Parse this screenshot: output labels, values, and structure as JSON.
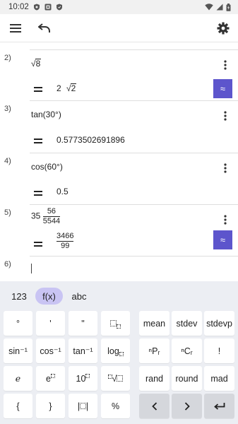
{
  "status_bar": {
    "time": "10:02",
    "left_icons": [
      "shield-icon",
      "notification-icon",
      "shield-icon"
    ],
    "right_icons": [
      "wifi-icon",
      "signal-icon",
      "battery-icon"
    ]
  },
  "toolbar": {
    "left_icons": [
      "menu-icon",
      "undo-icon"
    ],
    "right_icon": "gear-icon"
  },
  "rows": [
    {
      "num": "2)",
      "input": "√8",
      "input_radicand": "8",
      "result_coef": "2",
      "result_radicand": "2",
      "has_approx": true
    },
    {
      "num": "3)",
      "input": "tan(30°)",
      "result": "0.5773502691896",
      "has_approx": false
    },
    {
      "num": "4)",
      "input": "cos(60°)",
      "result": "0.5",
      "has_approx": false
    },
    {
      "num": "5)",
      "input_whole": "35",
      "input_num": "56",
      "input_den": "5544",
      "result_num": "3466",
      "result_den": "99",
      "has_approx": true
    },
    {
      "num": "6)",
      "input": "",
      "has_approx": false
    }
  ],
  "approx_label": "≈",
  "accent_color": "#5d55cc",
  "keyboard": {
    "tabs": [
      "123",
      "f(x)",
      "abc"
    ],
    "active_tab": "f(x)",
    "left_keys": [
      [
        "°",
        "'",
        "\"",
        "□□"
      ],
      [
        "sin⁻¹",
        "cos⁻¹",
        "tan⁻¹",
        "log□"
      ],
      [
        "e",
        "e□",
        "10□",
        "□√□"
      ],
      [
        "{",
        "}",
        "|□|",
        "%"
      ]
    ],
    "right_keys": [
      [
        "mean",
        "stdev",
        "stdevp"
      ],
      [
        "ⁿPᵣ",
        "ⁿCᵣ",
        "!"
      ],
      [
        "rand",
        "round",
        "mad"
      ],
      [
        "‹",
        "›",
        "↵"
      ]
    ]
  }
}
